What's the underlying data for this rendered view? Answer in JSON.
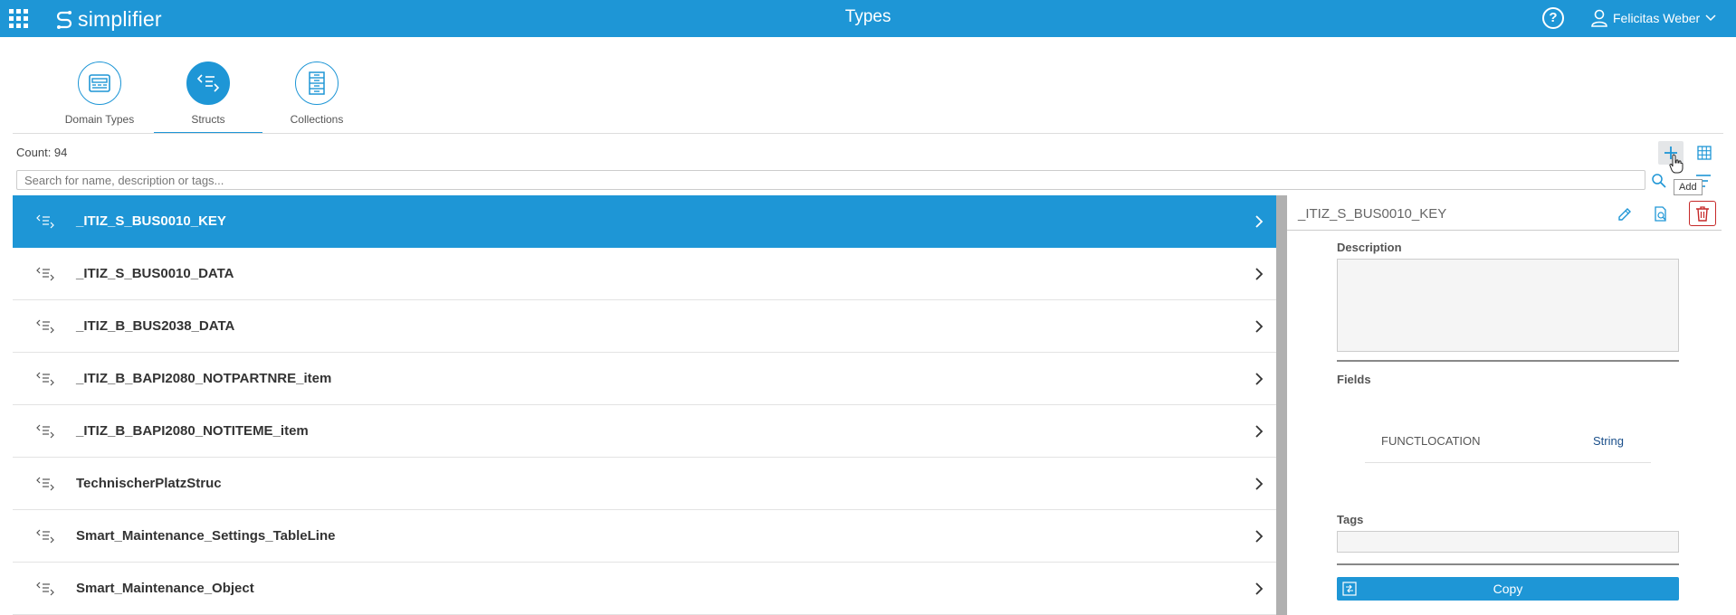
{
  "header": {
    "app_name": "simplifier",
    "page_title": "Types",
    "help_label": "?",
    "user_name": "Felicitas Weber",
    "accent_color": "#1e96d6"
  },
  "tabs": [
    {
      "label": "Domain Types",
      "icon": "domain-types-icon",
      "active": false
    },
    {
      "label": "Structs",
      "icon": "structs-icon",
      "active": true
    },
    {
      "label": "Collections",
      "icon": "collections-icon",
      "active": false
    }
  ],
  "toolbar": {
    "count_label": "Count: 94",
    "add_tooltip": "Add"
  },
  "search": {
    "placeholder": "Search for name, description or tags...",
    "value": ""
  },
  "structs": [
    {
      "name": "_ITIZ_S_BUS0010_KEY",
      "selected": true
    },
    {
      "name": "_ITIZ_S_BUS0010_DATA",
      "selected": false
    },
    {
      "name": "_ITIZ_B_BUS2038_DATA",
      "selected": false
    },
    {
      "name": "_ITIZ_B_BAPI2080_NOTPARTNRE_item",
      "selected": false
    },
    {
      "name": "_ITIZ_B_BAPI2080_NOTITEME_item",
      "selected": false
    },
    {
      "name": "TechnischerPlatzStruc",
      "selected": false
    },
    {
      "name": "Smart_Maintenance_Settings_TableLine",
      "selected": false
    },
    {
      "name": "Smart_Maintenance_Object",
      "selected": false
    }
  ],
  "detail": {
    "title": "_ITIZ_S_BUS0010_KEY",
    "description_label": "Description",
    "description_value": "",
    "fields_label": "Fields",
    "fields": [
      {
        "name": "FUNCTLOCATION",
        "type": "String"
      }
    ],
    "tags_label": "Tags",
    "copy_label": "Copy",
    "delete_color": "#c62828"
  }
}
